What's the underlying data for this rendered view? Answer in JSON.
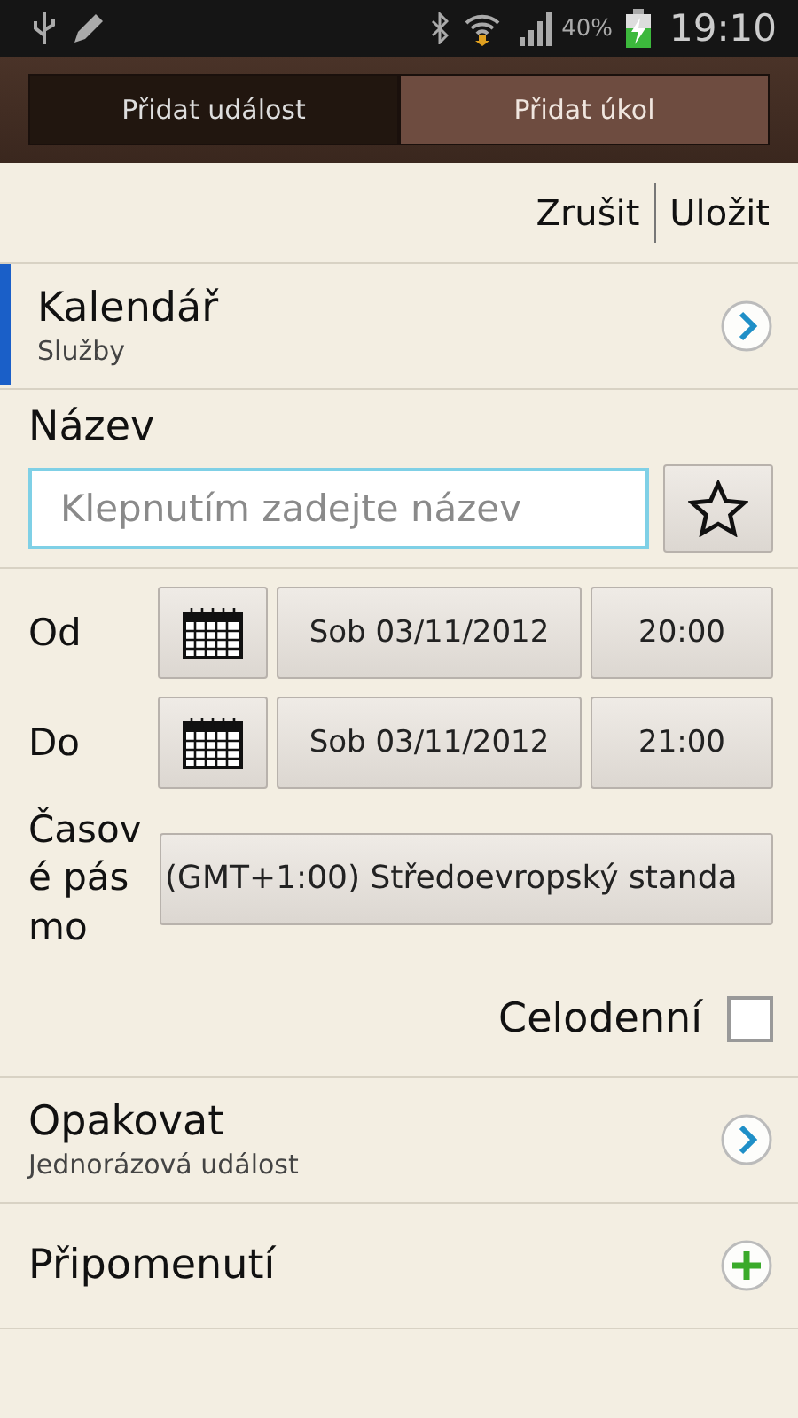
{
  "status_bar": {
    "battery": "40%",
    "time": "19:10"
  },
  "tabs": [
    {
      "label": "Přidat událost",
      "selected": true
    },
    {
      "label": "Přidat úkol",
      "selected": false
    }
  ],
  "actions": [
    "Zrušit",
    "Uložit"
  ],
  "calendar": {
    "title": "Kalendář",
    "value": "Služby",
    "color": "#1a5fc8"
  },
  "name": {
    "label": "Název",
    "placeholder": "Klepnutím zadejte název"
  },
  "times": [
    {
      "label": "Od",
      "date": "Sob 03/11/2012",
      "time": "20:00"
    },
    {
      "label": "Do",
      "date": "Sob 03/11/2012",
      "time": "21:00"
    }
  ],
  "timezone": {
    "label": "Časové pásmo",
    "value": "(GMT+1:00) Středoevropský standa"
  },
  "all_day": {
    "label": "Celodenní",
    "checked": false
  },
  "rows": [
    {
      "kind": "link",
      "title": "Opakovat",
      "value": "Jednorázová událost"
    },
    {
      "kind": "add",
      "title": "Připomenutí"
    }
  ]
}
